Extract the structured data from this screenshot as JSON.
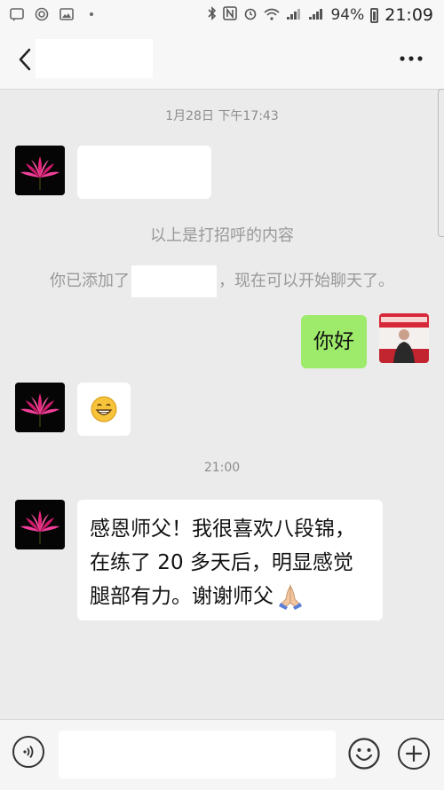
{
  "status_bar": {
    "battery": "94%",
    "time": "21:09",
    "signal_2g": "2G",
    "signal_4g": "4G"
  },
  "header": {
    "back_icon": "back-chevron-icon",
    "more_icon": "more-dots-icon"
  },
  "messages": {
    "timestamp_1": "1月28日 下午17:43",
    "system_greeting": "以上是打招呼的内容",
    "system_added_prefix": "你已添加了",
    "system_added_suffix": "，现在可以开始聊天了。",
    "outgoing_hello": "你好",
    "incoming_emoji": "grinning-face-emoji",
    "timestamp_2": "21:00",
    "incoming_long_line1": "感恩师父！我很喜欢八段锦，",
    "incoming_long_line2": "在练了 20 多天后，明显感觉",
    "incoming_long_line3": "腿部有力。谢谢师父"
  },
  "colors": {
    "outgoing_bubble": "#9eea6a",
    "incoming_bubble": "#ffffff",
    "background": "#ebebeb"
  }
}
